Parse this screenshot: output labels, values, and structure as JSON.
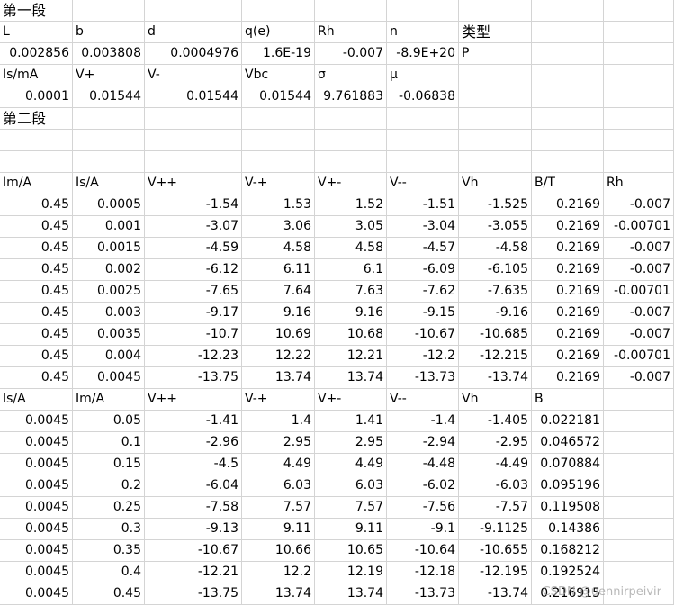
{
  "rows": [
    [
      {
        "t": "第一段",
        "h": true
      },
      "",
      "",
      "",
      "",
      "",
      "",
      "",
      ""
    ],
    [
      "L",
      "b",
      "d",
      "q(e)",
      "Rh",
      "n",
      {
        "t": "类型",
        "h": true
      },
      "",
      ""
    ],
    [
      {
        "t": "0.002856",
        "a": "r"
      },
      {
        "t": "0.003808",
        "a": "r"
      },
      {
        "t": "0.0004976",
        "a": "r"
      },
      {
        "t": "1.6E-19",
        "a": "r"
      },
      {
        "t": "-0.007",
        "a": "r"
      },
      {
        "t": "-8.9E+20",
        "a": "r"
      },
      "P",
      "",
      ""
    ],
    [
      "Is/mA",
      "V+",
      "V-",
      "Vbc",
      "σ",
      "μ",
      "",
      "",
      ""
    ],
    [
      {
        "t": "0.0001",
        "a": "r"
      },
      {
        "t": "0.01544",
        "a": "r"
      },
      {
        "t": "0.01544",
        "a": "r"
      },
      {
        "t": "0.01544",
        "a": "r"
      },
      {
        "t": "9.761883",
        "a": "r"
      },
      {
        "t": "-0.06838",
        "a": "r"
      },
      "",
      "",
      ""
    ],
    [
      {
        "t": "第二段",
        "h": true
      },
      "",
      "",
      "",
      "",
      "",
      "",
      "",
      ""
    ],
    [
      "",
      "",
      "",
      "",
      "",
      "",
      "",
      "",
      ""
    ],
    [
      "",
      "",
      "",
      "",
      "",
      "",
      "",
      "",
      ""
    ],
    [
      "Im/A",
      "Is/A",
      "V++",
      "V-+",
      "V+-",
      "V--",
      "Vh",
      "B/T",
      "Rh"
    ],
    [
      {
        "t": "0.45",
        "a": "r"
      },
      {
        "t": "0.0005",
        "a": "r"
      },
      {
        "t": "-1.54",
        "a": "r"
      },
      {
        "t": "1.53",
        "a": "r"
      },
      {
        "t": "1.52",
        "a": "r"
      },
      {
        "t": "-1.51",
        "a": "r"
      },
      {
        "t": "-1.525",
        "a": "r"
      },
      {
        "t": "0.2169",
        "a": "r"
      },
      {
        "t": "-0.007",
        "a": "r"
      }
    ],
    [
      {
        "t": "0.45",
        "a": "r"
      },
      {
        "t": "0.001",
        "a": "r"
      },
      {
        "t": "-3.07",
        "a": "r"
      },
      {
        "t": "3.06",
        "a": "r"
      },
      {
        "t": "3.05",
        "a": "r"
      },
      {
        "t": "-3.04",
        "a": "r"
      },
      {
        "t": "-3.055",
        "a": "r"
      },
      {
        "t": "0.2169",
        "a": "r"
      },
      {
        "t": "-0.00701",
        "a": "r"
      }
    ],
    [
      {
        "t": "0.45",
        "a": "r"
      },
      {
        "t": "0.0015",
        "a": "r"
      },
      {
        "t": "-4.59",
        "a": "r"
      },
      {
        "t": "4.58",
        "a": "r"
      },
      {
        "t": "4.58",
        "a": "r"
      },
      {
        "t": "-4.57",
        "a": "r"
      },
      {
        "t": "-4.58",
        "a": "r"
      },
      {
        "t": "0.2169",
        "a": "r"
      },
      {
        "t": "-0.007",
        "a": "r"
      }
    ],
    [
      {
        "t": "0.45",
        "a": "r"
      },
      {
        "t": "0.002",
        "a": "r"
      },
      {
        "t": "-6.12",
        "a": "r"
      },
      {
        "t": "6.11",
        "a": "r"
      },
      {
        "t": "6.1",
        "a": "r"
      },
      {
        "t": "-6.09",
        "a": "r"
      },
      {
        "t": "-6.105",
        "a": "r"
      },
      {
        "t": "0.2169",
        "a": "r"
      },
      {
        "t": "-0.007",
        "a": "r"
      }
    ],
    [
      {
        "t": "0.45",
        "a": "r"
      },
      {
        "t": "0.0025",
        "a": "r"
      },
      {
        "t": "-7.65",
        "a": "r"
      },
      {
        "t": "7.64",
        "a": "r"
      },
      {
        "t": "7.63",
        "a": "r"
      },
      {
        "t": "-7.62",
        "a": "r"
      },
      {
        "t": "-7.635",
        "a": "r"
      },
      {
        "t": "0.2169",
        "a": "r"
      },
      {
        "t": "-0.00701",
        "a": "r"
      }
    ],
    [
      {
        "t": "0.45",
        "a": "r"
      },
      {
        "t": "0.003",
        "a": "r"
      },
      {
        "t": "-9.17",
        "a": "r"
      },
      {
        "t": "9.16",
        "a": "r"
      },
      {
        "t": "9.16",
        "a": "r"
      },
      {
        "t": "-9.15",
        "a": "r"
      },
      {
        "t": "-9.16",
        "a": "r"
      },
      {
        "t": "0.2169",
        "a": "r"
      },
      {
        "t": "-0.007",
        "a": "r"
      }
    ],
    [
      {
        "t": "0.45",
        "a": "r"
      },
      {
        "t": "0.0035",
        "a": "r"
      },
      {
        "t": "-10.7",
        "a": "r"
      },
      {
        "t": "10.69",
        "a": "r"
      },
      {
        "t": "10.68",
        "a": "r"
      },
      {
        "t": "-10.67",
        "a": "r"
      },
      {
        "t": "-10.685",
        "a": "r"
      },
      {
        "t": "0.2169",
        "a": "r"
      },
      {
        "t": "-0.007",
        "a": "r"
      }
    ],
    [
      {
        "t": "0.45",
        "a": "r"
      },
      {
        "t": "0.004",
        "a": "r"
      },
      {
        "t": "-12.23",
        "a": "r"
      },
      {
        "t": "12.22",
        "a": "r"
      },
      {
        "t": "12.21",
        "a": "r"
      },
      {
        "t": "-12.2",
        "a": "r"
      },
      {
        "t": "-12.215",
        "a": "r"
      },
      {
        "t": "0.2169",
        "a": "r"
      },
      {
        "t": "-0.00701",
        "a": "r"
      }
    ],
    [
      {
        "t": "0.45",
        "a": "r"
      },
      {
        "t": "0.0045",
        "a": "r"
      },
      {
        "t": "-13.75",
        "a": "r"
      },
      {
        "t": "13.74",
        "a": "r"
      },
      {
        "t": "13.74",
        "a": "r"
      },
      {
        "t": "-13.73",
        "a": "r"
      },
      {
        "t": "-13.74",
        "a": "r"
      },
      {
        "t": "0.2169",
        "a": "r"
      },
      {
        "t": "-0.007",
        "a": "r"
      }
    ],
    [
      "Is/A",
      "Im/A",
      "V++",
      "V-+",
      "V+-",
      "V--",
      "Vh",
      "B",
      ""
    ],
    [
      {
        "t": "0.0045",
        "a": "r"
      },
      {
        "t": "0.05",
        "a": "r"
      },
      {
        "t": "-1.41",
        "a": "r"
      },
      {
        "t": "1.4",
        "a": "r"
      },
      {
        "t": "1.41",
        "a": "r"
      },
      {
        "t": "-1.4",
        "a": "r"
      },
      {
        "t": "-1.405",
        "a": "r"
      },
      {
        "t": "0.022181",
        "a": "r"
      },
      ""
    ],
    [
      {
        "t": "0.0045",
        "a": "r"
      },
      {
        "t": "0.1",
        "a": "r"
      },
      {
        "t": "-2.96",
        "a": "r"
      },
      {
        "t": "2.95",
        "a": "r"
      },
      {
        "t": "2.95",
        "a": "r"
      },
      {
        "t": "-2.94",
        "a": "r"
      },
      {
        "t": "-2.95",
        "a": "r"
      },
      {
        "t": "0.046572",
        "a": "r"
      },
      ""
    ],
    [
      {
        "t": "0.0045",
        "a": "r"
      },
      {
        "t": "0.15",
        "a": "r"
      },
      {
        "t": "-4.5",
        "a": "r"
      },
      {
        "t": "4.49",
        "a": "r"
      },
      {
        "t": "4.49",
        "a": "r"
      },
      {
        "t": "-4.48",
        "a": "r"
      },
      {
        "t": "-4.49",
        "a": "r"
      },
      {
        "t": "0.070884",
        "a": "r"
      },
      ""
    ],
    [
      {
        "t": "0.0045",
        "a": "r"
      },
      {
        "t": "0.2",
        "a": "r"
      },
      {
        "t": "-6.04",
        "a": "r"
      },
      {
        "t": "6.03",
        "a": "r"
      },
      {
        "t": "6.03",
        "a": "r"
      },
      {
        "t": "-6.02",
        "a": "r"
      },
      {
        "t": "-6.03",
        "a": "r"
      },
      {
        "t": "0.095196",
        "a": "r"
      },
      ""
    ],
    [
      {
        "t": "0.0045",
        "a": "r"
      },
      {
        "t": "0.25",
        "a": "r"
      },
      {
        "t": "-7.58",
        "a": "r"
      },
      {
        "t": "7.57",
        "a": "r"
      },
      {
        "t": "7.57",
        "a": "r"
      },
      {
        "t": "-7.56",
        "a": "r"
      },
      {
        "t": "-7.57",
        "a": "r"
      },
      {
        "t": "0.119508",
        "a": "r"
      },
      ""
    ],
    [
      {
        "t": "0.0045",
        "a": "r"
      },
      {
        "t": "0.3",
        "a": "r"
      },
      {
        "t": "-9.13",
        "a": "r"
      },
      {
        "t": "9.11",
        "a": "r"
      },
      {
        "t": "9.11",
        "a": "r"
      },
      {
        "t": "-9.1",
        "a": "r"
      },
      {
        "t": "-9.1125",
        "a": "r"
      },
      {
        "t": "0.14386",
        "a": "r"
      },
      ""
    ],
    [
      {
        "t": "0.0045",
        "a": "r"
      },
      {
        "t": "0.35",
        "a": "r"
      },
      {
        "t": "-10.67",
        "a": "r"
      },
      {
        "t": "10.66",
        "a": "r"
      },
      {
        "t": "10.65",
        "a": "r"
      },
      {
        "t": "-10.64",
        "a": "r"
      },
      {
        "t": "-10.655",
        "a": "r"
      },
      {
        "t": "0.168212",
        "a": "r"
      },
      ""
    ],
    [
      {
        "t": "0.0045",
        "a": "r"
      },
      {
        "t": "0.4",
        "a": "r"
      },
      {
        "t": "-12.21",
        "a": "r"
      },
      {
        "t": "12.2",
        "a": "r"
      },
      {
        "t": "12.19",
        "a": "r"
      },
      {
        "t": "-12.18",
        "a": "r"
      },
      {
        "t": "-12.195",
        "a": "r"
      },
      {
        "t": "0.192524",
        "a": "r"
      },
      ""
    ],
    [
      {
        "t": "0.0045",
        "a": "r"
      },
      {
        "t": "0.45",
        "a": "r"
      },
      {
        "t": "-13.75",
        "a": "r"
      },
      {
        "t": "13.74",
        "a": "r"
      },
      {
        "t": "13.74",
        "a": "r"
      },
      {
        "t": "-13.73",
        "a": "r"
      },
      {
        "t": "-13.74",
        "a": "r"
      },
      {
        "t": "0.216915",
        "a": "r"
      },
      ""
    ]
  ],
  "watermark": "CSDN @uennirpeivir"
}
